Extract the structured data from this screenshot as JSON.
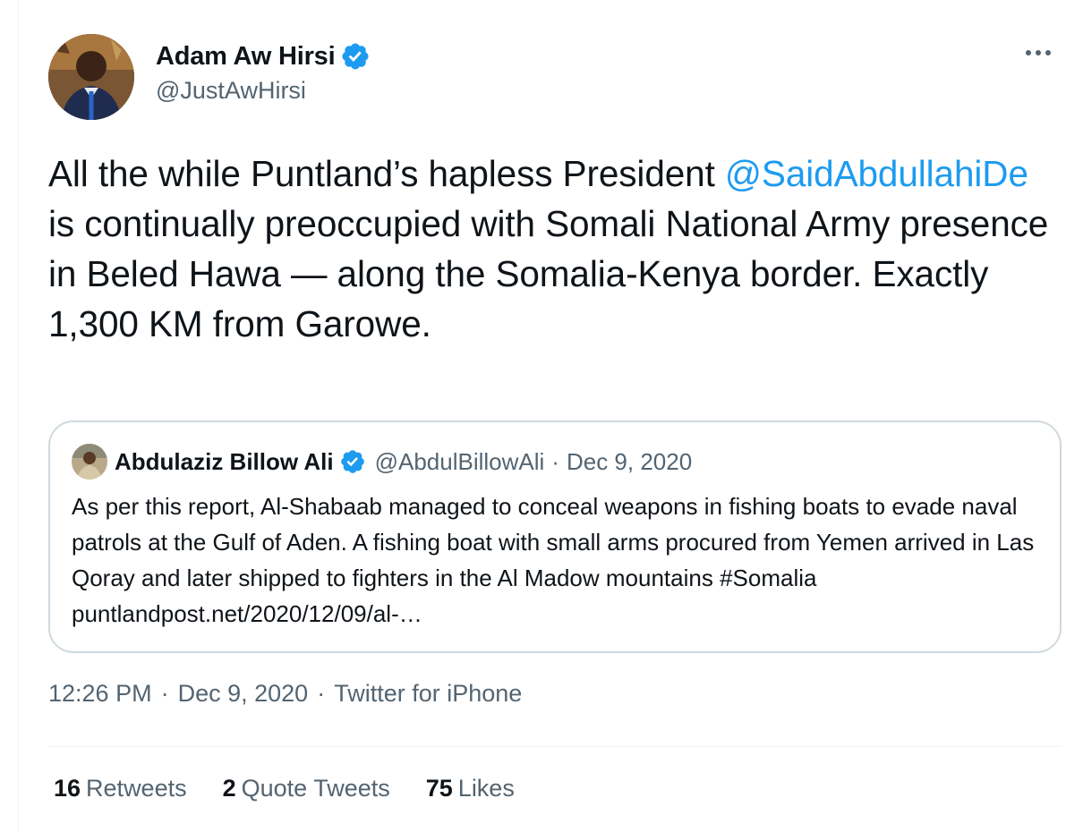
{
  "author": {
    "display_name": "Adam Aw Hirsi",
    "handle": "@JustAwHirsi",
    "verified_icon": "verified-badge-icon"
  },
  "tweet": {
    "text_before": "All the while Puntland’s hapless President ",
    "mention": "@SaidAbdullahiDe",
    "text_after": " is continually preoccupied with Somali National Army presence in Beled Hawa — along the Somalia-Kenya border. Exactly 1,300 KM from Garowe."
  },
  "quoted_tweet": {
    "display_name": "Abdulaziz Billow Ali",
    "handle": "@AbdulBillowAli",
    "separator": "·",
    "date": "Dec 9, 2020",
    "text": "As per this report, Al-Shabaab managed to conceal weapons in fishing boats to evade naval patrols at the Gulf of Aden. A fishing boat with small arms procured from Yemen arrived in Las Qoray and later shipped to fighters in the Al Madow mountains #Somalia puntlandpost.net/2020/12/09/al-…"
  },
  "meta": {
    "time": "12:26 PM",
    "separator": "·",
    "date": "Dec 9, 2020",
    "source": "Twitter for iPhone"
  },
  "stats": {
    "retweets_count": "16",
    "retweets_label": "Retweets",
    "quotes_count": "2",
    "quotes_label": "Quote Tweets",
    "likes_count": "75",
    "likes_label": "Likes"
  },
  "colors": {
    "accent": "#1d9bf0",
    "text_primary": "#0f1419",
    "text_secondary": "#536471",
    "border": "#cfd9de"
  }
}
